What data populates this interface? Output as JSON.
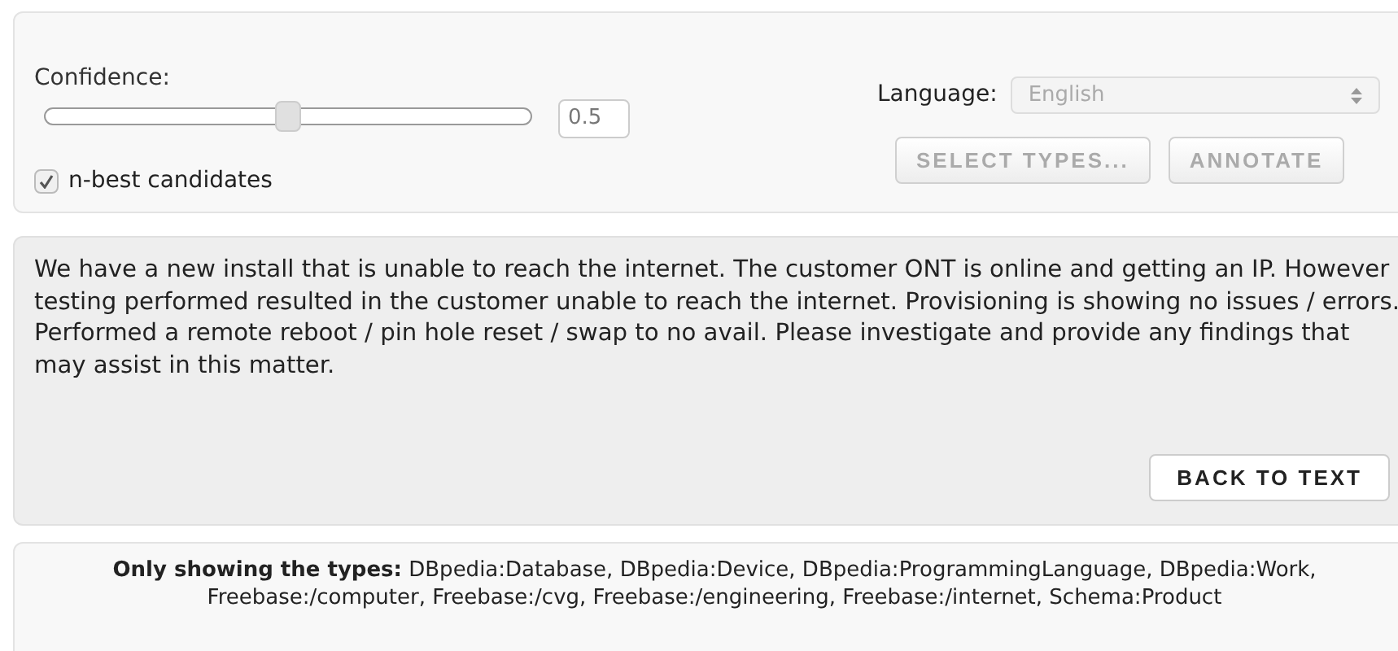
{
  "confidence": {
    "label": "Confidence:",
    "level": 0.5,
    "value": "0.5"
  },
  "n_best": {
    "label": "n-best candidates",
    "checked": true
  },
  "language": {
    "label": "Language:",
    "value": "English",
    "disabled": true
  },
  "buttons": [
    {
      "label": "SELECT TYPES...",
      "disabled": true
    },
    {
      "label": "ANNOTATE",
      "disabled": true
    }
  ],
  "text_panel": {
    "text": "We have a new install that is unable to reach the internet. The customer ONT is online and getting an IP. However testing performed resulted in the customer unable to reach the internet. Provisioning is showing no issues / errors. Performed a remote reboot / pin hole reset / swap to no avail. Please investigate and provide any findings that may assist in this matter.",
    "button": {
      "label": "BACK TO TEXT",
      "disabled": false
    }
  },
  "types_panel": {
    "text": "**Only showing the types:** DBpedia:Database, DBpedia:Device, DBpedia:ProgrammingLanguage, DBpedia:Work, Freebase:/computer, Freebase:/cvg, Freebase:/engineering, Freebase:/internet, Schema:Product"
  }
}
